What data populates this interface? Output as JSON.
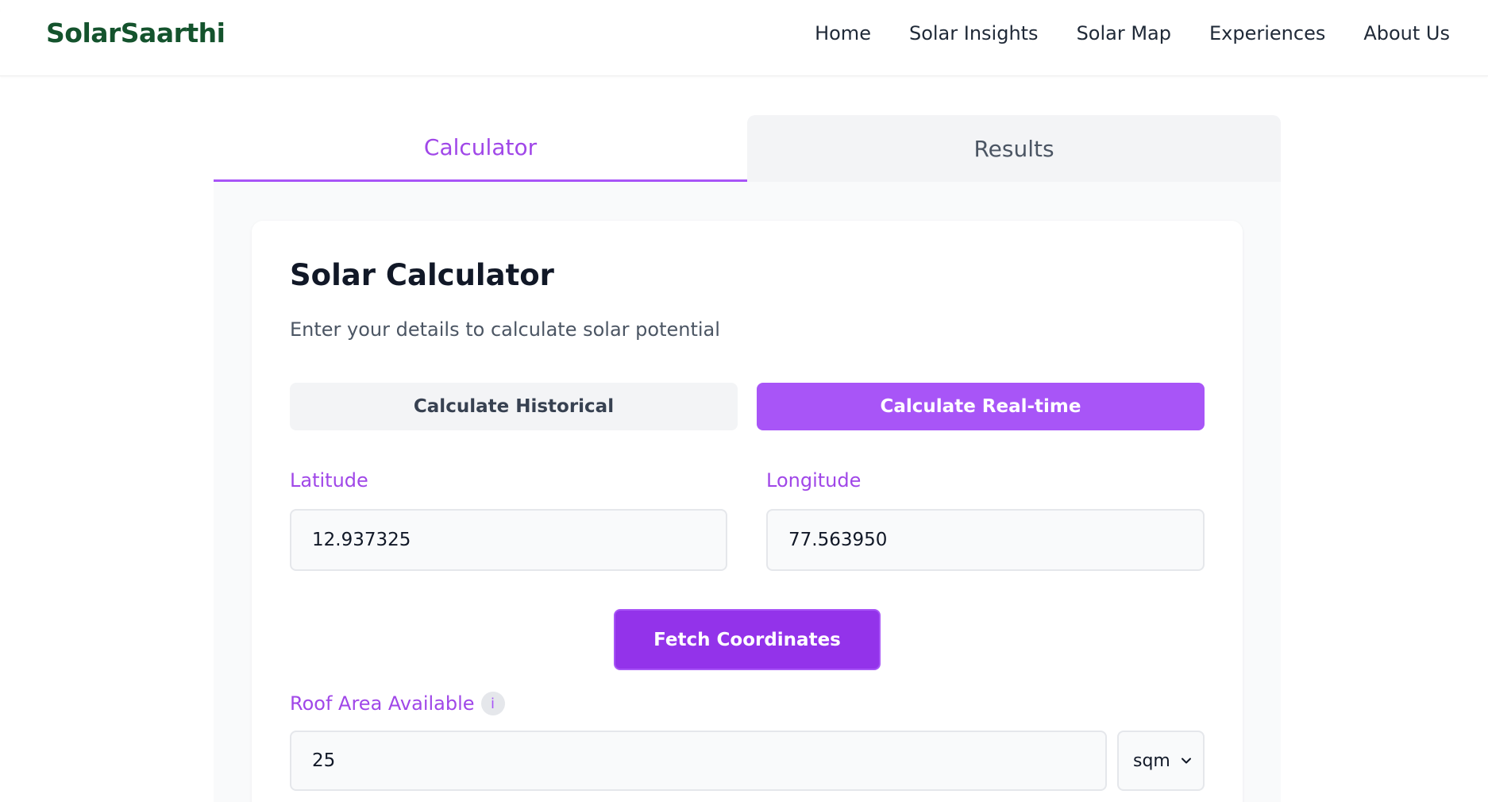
{
  "brand": {
    "name": "SolarSaarthi",
    "color": "#14532d"
  },
  "nav": {
    "items": [
      {
        "label": "Home"
      },
      {
        "label": "Solar Insights"
      },
      {
        "label": "Solar Map"
      },
      {
        "label": "Experiences"
      },
      {
        "label": "About Us"
      }
    ]
  },
  "tabs": {
    "items": [
      {
        "label": "Calculator",
        "active": true
      },
      {
        "label": "Results",
        "active": false
      }
    ]
  },
  "calculator": {
    "title": "Solar Calculator",
    "subtitle": "Enter your details to calculate solar potential",
    "modes": {
      "historical_label": "Calculate Historical",
      "realtime_label": "Calculate Real-time",
      "selected": "Calculate Real-time"
    },
    "latitude": {
      "label": "Latitude",
      "value": "12.937325"
    },
    "longitude": {
      "label": "Longitude",
      "value": "77.563950"
    },
    "fetch_label": "Fetch Coordinates",
    "roof_area": {
      "label": "Roof Area Available",
      "info_glyph": "i",
      "value": "25",
      "unit": "sqm"
    }
  },
  "colors": {
    "accent": "#a855f7",
    "accent_dark": "#9333ea",
    "label": "#a047e8"
  },
  "icons": {
    "info": "info-icon",
    "unit_dropdown": "chevron-down-icon"
  }
}
